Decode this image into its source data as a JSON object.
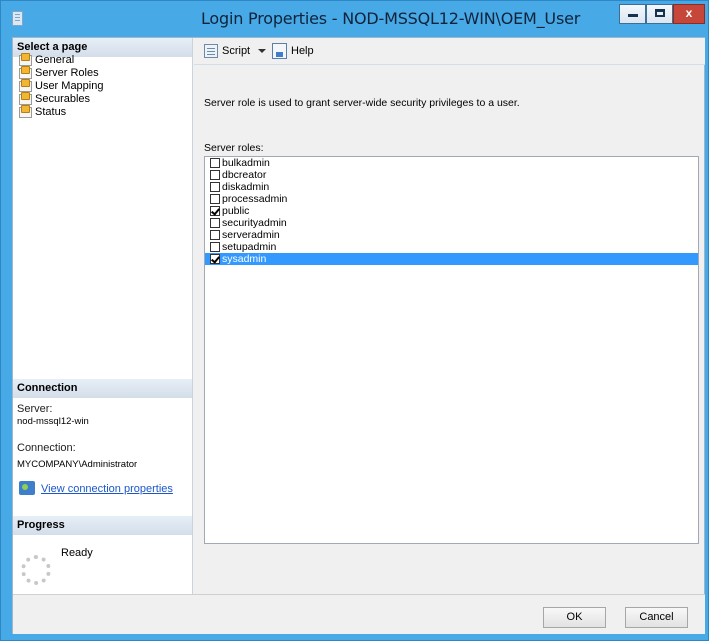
{
  "window": {
    "title": "Login Properties - NOD-MSSQL12-WIN\\OEM_User",
    "controls": {
      "minimize": "minimize-icon",
      "maximize": "maximize-icon",
      "close": "x"
    }
  },
  "sidebar": {
    "select_page_header": "Select a page",
    "pages": [
      {
        "label": "General",
        "icon": "page-icon"
      },
      {
        "label": "Server Roles",
        "icon": "page-icon"
      },
      {
        "label": "User Mapping",
        "icon": "page-icon"
      },
      {
        "label": "Securables",
        "icon": "page-icon"
      },
      {
        "label": "Status",
        "icon": "page-icon"
      }
    ],
    "connection_header": "Connection",
    "server_label": "Server:",
    "server_value": "nod-mssql12-win",
    "connection_label": "Connection:",
    "connection_value": "MYCOMPANY\\Administrator",
    "view_connection_link": "View connection properties",
    "progress_header": "Progress",
    "progress_status": "Ready"
  },
  "toolbar": {
    "script_label": "Script",
    "help_label": "Help"
  },
  "main": {
    "description": "Server role is used to grant server-wide security privileges to a user.",
    "roles_label": "Server roles:",
    "roles": [
      {
        "name": "bulkadmin",
        "checked": false,
        "selected": false
      },
      {
        "name": "dbcreator",
        "checked": false,
        "selected": false
      },
      {
        "name": "diskadmin",
        "checked": false,
        "selected": false
      },
      {
        "name": "processadmin",
        "checked": false,
        "selected": false
      },
      {
        "name": "public",
        "checked": true,
        "selected": false
      },
      {
        "name": "securityadmin",
        "checked": false,
        "selected": false
      },
      {
        "name": "serveradmin",
        "checked": false,
        "selected": false
      },
      {
        "name": "setupadmin",
        "checked": false,
        "selected": false
      },
      {
        "name": "sysadmin",
        "checked": true,
        "selected": true
      }
    ]
  },
  "footer": {
    "ok_label": "OK",
    "cancel_label": "Cancel"
  },
  "colors": {
    "titlebar": "#47a9e6",
    "selection": "#3399ff",
    "link": "#1c57c9",
    "close_button": "#c7463a"
  }
}
